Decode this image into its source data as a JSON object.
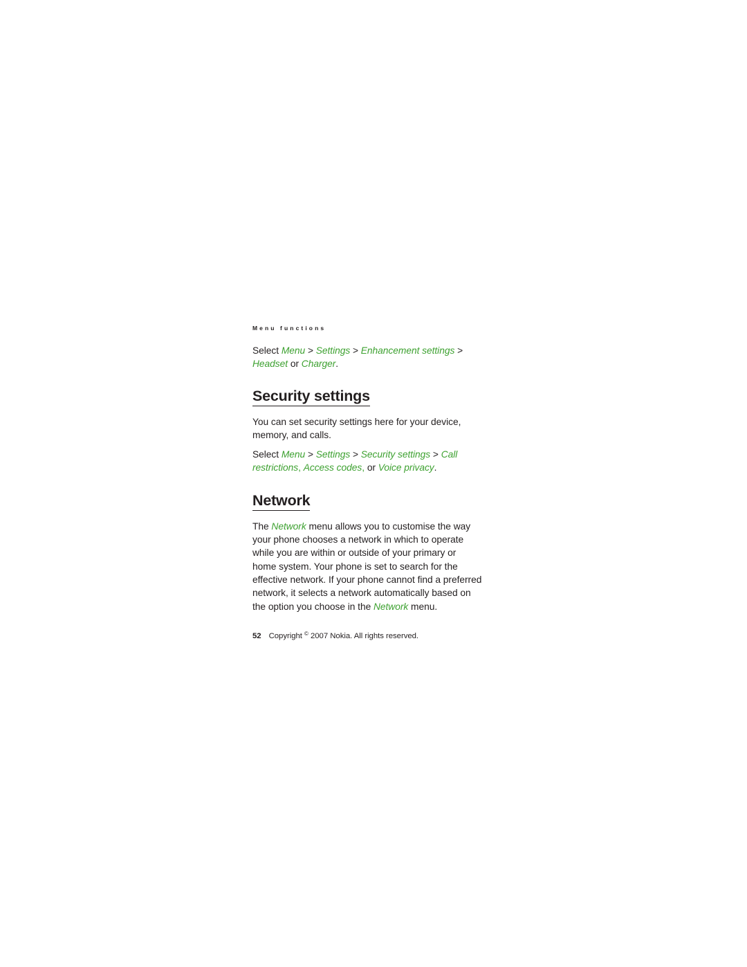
{
  "page": {
    "running_header": "Menu functions",
    "background_color": "#ffffff",
    "text_color": "#231f20",
    "accent_color": "#3da130"
  },
  "select_line_1": {
    "lead": "Select ",
    "item1": "Menu",
    "sep1": " > ",
    "item2": "Settings",
    "sep2": " > ",
    "item3": "Enhancement settings",
    "sep3": " > ",
    "item4": "Headset",
    "conj": " or ",
    "item5": "Charger",
    "end": "."
  },
  "security": {
    "heading": "Security settings",
    "paragraph": "You can set security settings here for your device, memory, and calls.",
    "select_line": {
      "lead": "Select ",
      "item1": "Menu",
      "sep1": " > ",
      "item2": "Settings",
      "sep2": " > ",
      "item3": "Security settings",
      "sep3": " > ",
      "item4": "Call restrictions",
      "comma1": ",",
      "space1": " ",
      "item5": "Access codes",
      "comma2": ",",
      "conj": " or ",
      "item6": "Voice privacy",
      "end": "."
    }
  },
  "network": {
    "heading": "Network",
    "paragraph_part1": "The ",
    "term1": "Network",
    "paragraph_part2": " menu allows you to customise the way your phone chooses a network in which to operate while you are within or outside of your primary or home system. Your phone is set to search for the effective network. If your phone cannot find a preferred network, it selects a network automatically based on the option you choose in the ",
    "term2": "Network",
    "paragraph_part3": " menu."
  },
  "footer": {
    "page_number": "52",
    "copyright_prefix": "Copyright ",
    "copyright_symbol": "©",
    "copyright_text": " 2007 Nokia. All rights reserved."
  }
}
